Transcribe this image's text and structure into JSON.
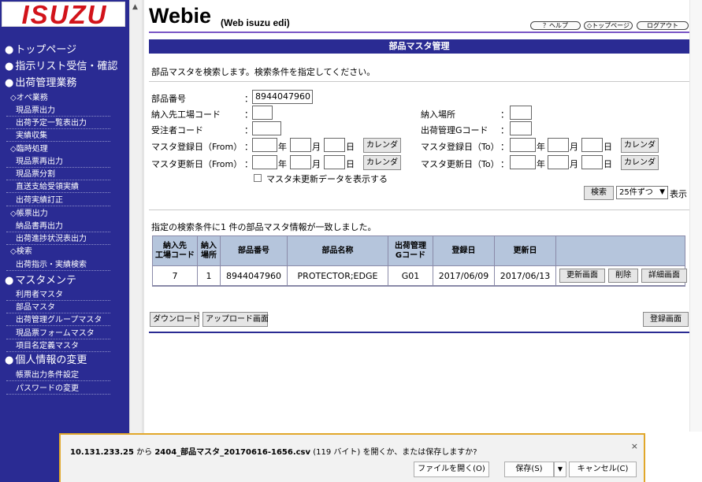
{
  "logo": {
    "text": "ISUZU",
    "color": "#d2131a"
  },
  "sidebar": {
    "main_items": [
      "トップページ",
      "指示リスト受信・確認",
      "出荷管理業務",
      "マスタメンテ",
      "個人情報の変更"
    ],
    "categories": [
      "◇オペ業務",
      "◇臨時処理",
      "◇帳票出力",
      "◇検索"
    ],
    "sub_items": [
      "現品票出力",
      "出荷予定一覧表出力",
      "実績収集",
      "現品票再出力",
      "現品票分割",
      "直送支給受領実績",
      "出荷実績訂正",
      "納品書再出力",
      "出荷進捗状況表出力",
      "出荷指示・実績検索",
      "利用者マスタ",
      "部品マスタ",
      "出荷管理グループマスタ",
      "現品票フォームマスタ",
      "項目名定義マスタ",
      "帳票出力条件設定",
      "パスワードの変更"
    ],
    "bullet": "●"
  },
  "header": {
    "title": "Webie",
    "subtitle": "(Web isuzu edi)",
    "buttons": [
      "？ヘルプ",
      "◇トップページ",
      "ログアウト"
    ]
  },
  "banner": "部品マスタ管理",
  "intro": "部品マスタを検索します。検索条件を指定してください。",
  "form": {
    "part_number_label": "部品番号",
    "part_number_value": "8944047960",
    "dest_factory_label": "納入先工場コード",
    "dest_place_label": "納入場所",
    "orderer_label": "受注者コード",
    "ship_group_label": "出荷管理Gコード",
    "reg_from_label": "マスタ登録日（From）",
    "reg_to_label": "マスタ登録日（To）",
    "upd_from_label": "マスタ更新日（From）",
    "upd_to_label": "マスタ更新日（To）",
    "colon": "：",
    "year": "年",
    "month": "月",
    "day": "日",
    "calendar": "カレンダ",
    "checkbox_label": "マスタ未更新データを表示する",
    "search_button": "検索",
    "page_size": "25件ずつ",
    "page_size_suffix": "表示"
  },
  "result_message": "指定の検索条件に1 件の部品マスタ情報が一致しました。",
  "table": {
    "headers": [
      "納入先\n工場コード",
      "納入\n場所",
      "部品番号",
      "部品名称",
      "出荷管理\nGコード",
      "登録日",
      "更新日"
    ],
    "rows": [
      {
        "factory": "7",
        "place": "1",
        "part_no": "8944047960",
        "part_name": "PROTECTOR;EDGE",
        "group": "G01",
        "registered": "2017/06/09",
        "updated": "2017/06/13",
        "actions": [
          "更新画面",
          "削除",
          "詳細画面"
        ]
      }
    ]
  },
  "bottom_buttons": {
    "download": "ダウンロード",
    "upload": "アップロード画面",
    "register": "登録画面"
  },
  "download_bar": {
    "host": "10.131.233.25",
    "from": " から ",
    "filename": "2404_部品マスタ_20170616-1656.csv",
    "size": " (119 バイト) ",
    "question": "を開くか、または保存しますか?",
    "open": "ファイルを開く(O)",
    "save": "保存(S)",
    "cancel": "キャンセル(C)",
    "close": "×"
  },
  "colors": {
    "navy": "#2a2b93",
    "table_header": "#b5c5dc",
    "accent_rule": "#7a56c6",
    "dl_border": "#e1a72a"
  }
}
